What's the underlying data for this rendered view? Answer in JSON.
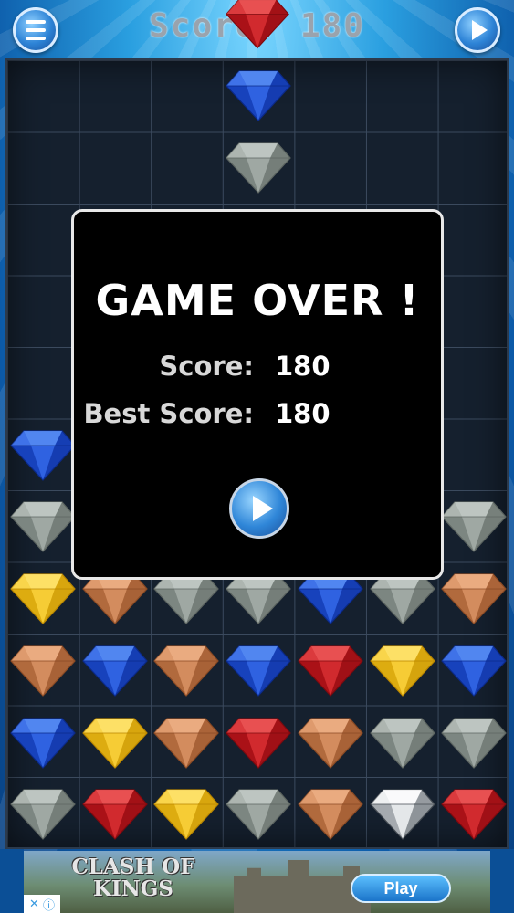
{
  "top_bar": {
    "score_text": "Score: 180",
    "menu_icon": "hamburger-menu-icon",
    "play_icon": "play-icon"
  },
  "board": {
    "columns": 7,
    "rows": 11,
    "falling_gem": "red",
    "gems": [
      {
        "col": 3,
        "row": 0,
        "color": "blue"
      },
      {
        "col": 3,
        "row": 1,
        "color": "gray"
      },
      {
        "col": 0,
        "row": 5,
        "color": "blue"
      },
      {
        "col": 0,
        "row": 6,
        "color": "gray"
      },
      {
        "col": 6,
        "row": 6,
        "color": "gray"
      },
      {
        "col": 0,
        "row": 7,
        "color": "yellow"
      },
      {
        "col": 1,
        "row": 7,
        "color": "copper"
      },
      {
        "col": 2,
        "row": 7,
        "color": "gray"
      },
      {
        "col": 3,
        "row": 7,
        "color": "gray"
      },
      {
        "col": 4,
        "row": 7,
        "color": "blue"
      },
      {
        "col": 5,
        "row": 7,
        "color": "gray"
      },
      {
        "col": 6,
        "row": 7,
        "color": "copper"
      },
      {
        "col": 0,
        "row": 8,
        "color": "copper"
      },
      {
        "col": 1,
        "row": 8,
        "color": "blue"
      },
      {
        "col": 2,
        "row": 8,
        "color": "copper"
      },
      {
        "col": 3,
        "row": 8,
        "color": "blue"
      },
      {
        "col": 4,
        "row": 8,
        "color": "red"
      },
      {
        "col": 5,
        "row": 8,
        "color": "yellow"
      },
      {
        "col": 6,
        "row": 8,
        "color": "blue"
      },
      {
        "col": 0,
        "row": 9,
        "color": "blue"
      },
      {
        "col": 1,
        "row": 9,
        "color": "yellow"
      },
      {
        "col": 2,
        "row": 9,
        "color": "copper"
      },
      {
        "col": 3,
        "row": 9,
        "color": "red"
      },
      {
        "col": 4,
        "row": 9,
        "color": "copper"
      },
      {
        "col": 5,
        "row": 9,
        "color": "gray"
      },
      {
        "col": 6,
        "row": 9,
        "color": "gray"
      },
      {
        "col": 0,
        "row": 10,
        "color": "gray"
      },
      {
        "col": 1,
        "row": 10,
        "color": "red"
      },
      {
        "col": 2,
        "row": 10,
        "color": "yellow"
      },
      {
        "col": 3,
        "row": 10,
        "color": "gray"
      },
      {
        "col": 4,
        "row": 10,
        "color": "copper"
      },
      {
        "col": 5,
        "row": 10,
        "color": "diamond"
      },
      {
        "col": 6,
        "row": 10,
        "color": "red"
      }
    ]
  },
  "game_over": {
    "title": "GAME OVER !",
    "score_label": "Score:",
    "score_value": "180",
    "best_label": "Best Score:",
    "best_value": "180",
    "play_icon": "play-icon"
  },
  "ad": {
    "title_line1": "CLASH OF",
    "title_line2": "KINGS",
    "play_label": "Play",
    "choices_icons": [
      "close-icon",
      "info-icon"
    ]
  },
  "colors": {
    "blue": [
      "#1e4fd8",
      "#5b8ff5",
      "#0b2a8a"
    ],
    "gray": [
      "#8e9893",
      "#c6cdc9",
      "#5c6460"
    ],
    "yellow": [
      "#f2c21a",
      "#ffe574",
      "#b88500"
    ],
    "copper": [
      "#c77b4b",
      "#f0b48a",
      "#8a4a24"
    ],
    "red": [
      "#c4161c",
      "#ef5a5a",
      "#7c0a0f"
    ],
    "diamond": [
      "#d9dde0",
      "#ffffff",
      "#444b52"
    ]
  }
}
